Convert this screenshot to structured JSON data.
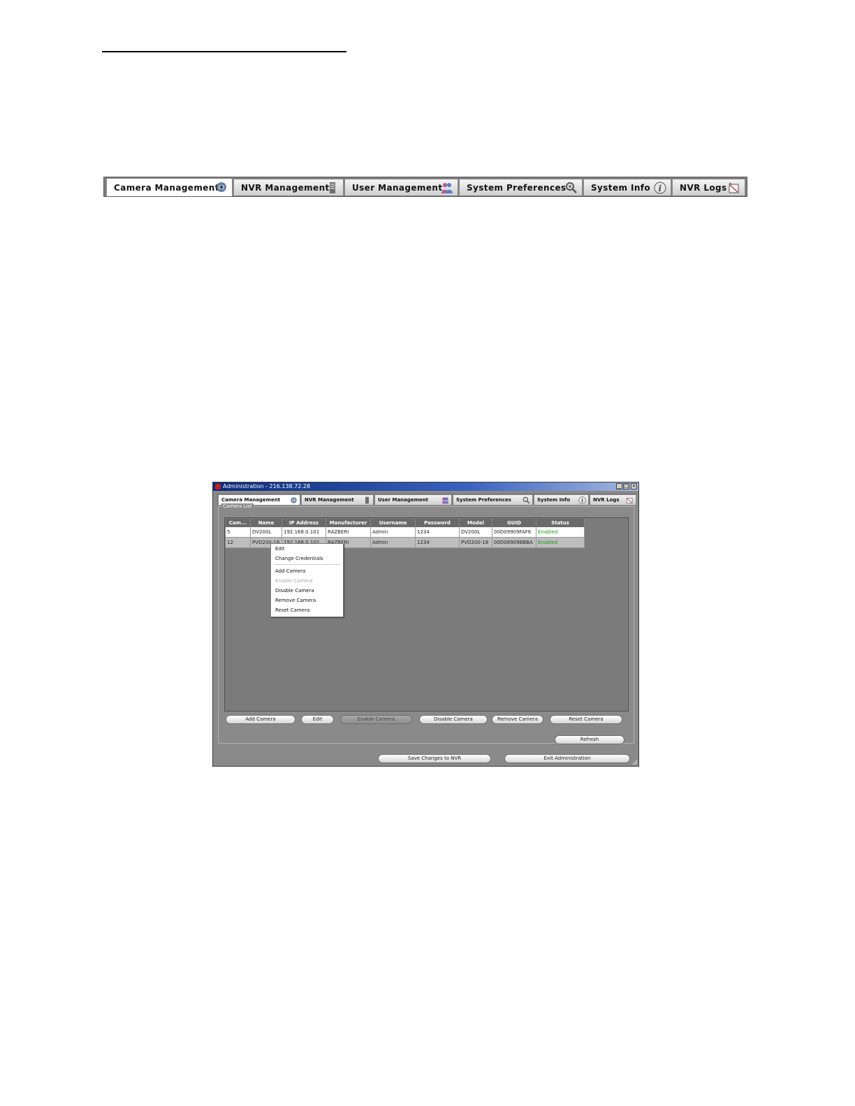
{
  "large_tabs": [
    {
      "label": "Camera Management",
      "icon": "camera-icon"
    },
    {
      "label": "NVR Management",
      "icon": "server-icon"
    },
    {
      "label": "User Management",
      "icon": "users-icon"
    },
    {
      "label": "System Preferences",
      "icon": "gear-magnifier-icon"
    },
    {
      "label": "System Info",
      "icon": "info-icon"
    },
    {
      "label": "NVR Logs",
      "icon": "logs-icon"
    }
  ],
  "window": {
    "title": "Administration - 216.138.72.28",
    "min_glyph": "_",
    "max_glyph": "□",
    "close_glyph": "×",
    "tabs": [
      {
        "label": "Camera Management"
      },
      {
        "label": "NVR Management"
      },
      {
        "label": "User Management"
      },
      {
        "label": "System Preferences"
      },
      {
        "label": "System Info"
      },
      {
        "label": "NVR Logs"
      }
    ],
    "panel_legend": "Camera List",
    "table": {
      "headers": [
        "Cam...",
        "Name",
        "IP Address",
        "Manufacturer",
        "Username",
        "Password",
        "Model",
        "GUID",
        "Status"
      ],
      "rows": [
        [
          "5",
          "DV200L",
          "192.168.0.101",
          "RAZBERI",
          "Admin",
          "1234",
          "DV200L",
          "00D09909FAF6",
          "Enabled"
        ],
        [
          "12",
          "PVD200-18",
          "192.168.0.102",
          "RAZBERI",
          "Admin",
          "1234",
          "PVD200-18",
          "00D08909BBBA",
          "Enabled"
        ]
      ]
    },
    "context_menu": {
      "items": [
        "Edit",
        "Change Credentials",
        "Add Camera",
        "Enable Camera",
        "Disable Camera",
        "Remove Camera",
        "Reset Camera"
      ]
    },
    "buttons": {
      "add_camera": "Add Camera",
      "edit": "Edit",
      "enable_camera": "Enable Camera",
      "disable_camera": "Disable Camera",
      "remove_camera": "Remove Camera",
      "reset_camera": "Reset Camera",
      "refresh": "Refresh",
      "save_changes": "Save Changes to NVR",
      "exit_admin": "Exit Administration"
    },
    "colors": {
      "status_enabled": "#1a9a1a",
      "titlebar": "#0b2a7a"
    }
  }
}
